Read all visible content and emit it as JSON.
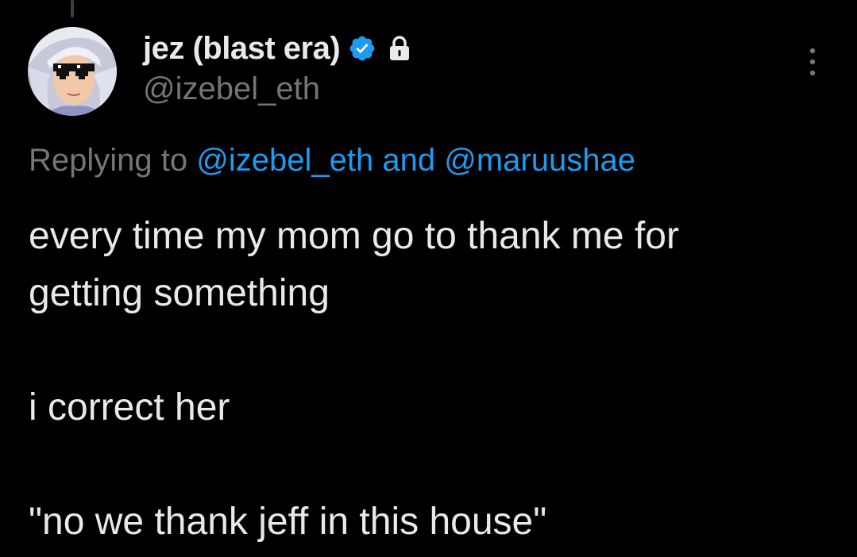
{
  "author": {
    "display_name": "jez (blast era)",
    "handle": "@izebel_eth",
    "verified": true,
    "protected": true,
    "avatar_icon": "anime-avatar-with-pixel-sunglasses"
  },
  "reply_context": {
    "prefix": "Replying to",
    "mention_1": "@izebel_eth",
    "joiner": "and",
    "mention_2": "@maruushae"
  },
  "tweet": {
    "line_1": "every time my mom go to thank me for",
    "line_2": "getting something",
    "line_3": "i correct her",
    "line_4": "\"no we thank jeff in this house\""
  },
  "colors": {
    "background": "#000000",
    "text": "#e7e9ea",
    "secondary": "#71767b",
    "accent": "#1d9bf0"
  }
}
